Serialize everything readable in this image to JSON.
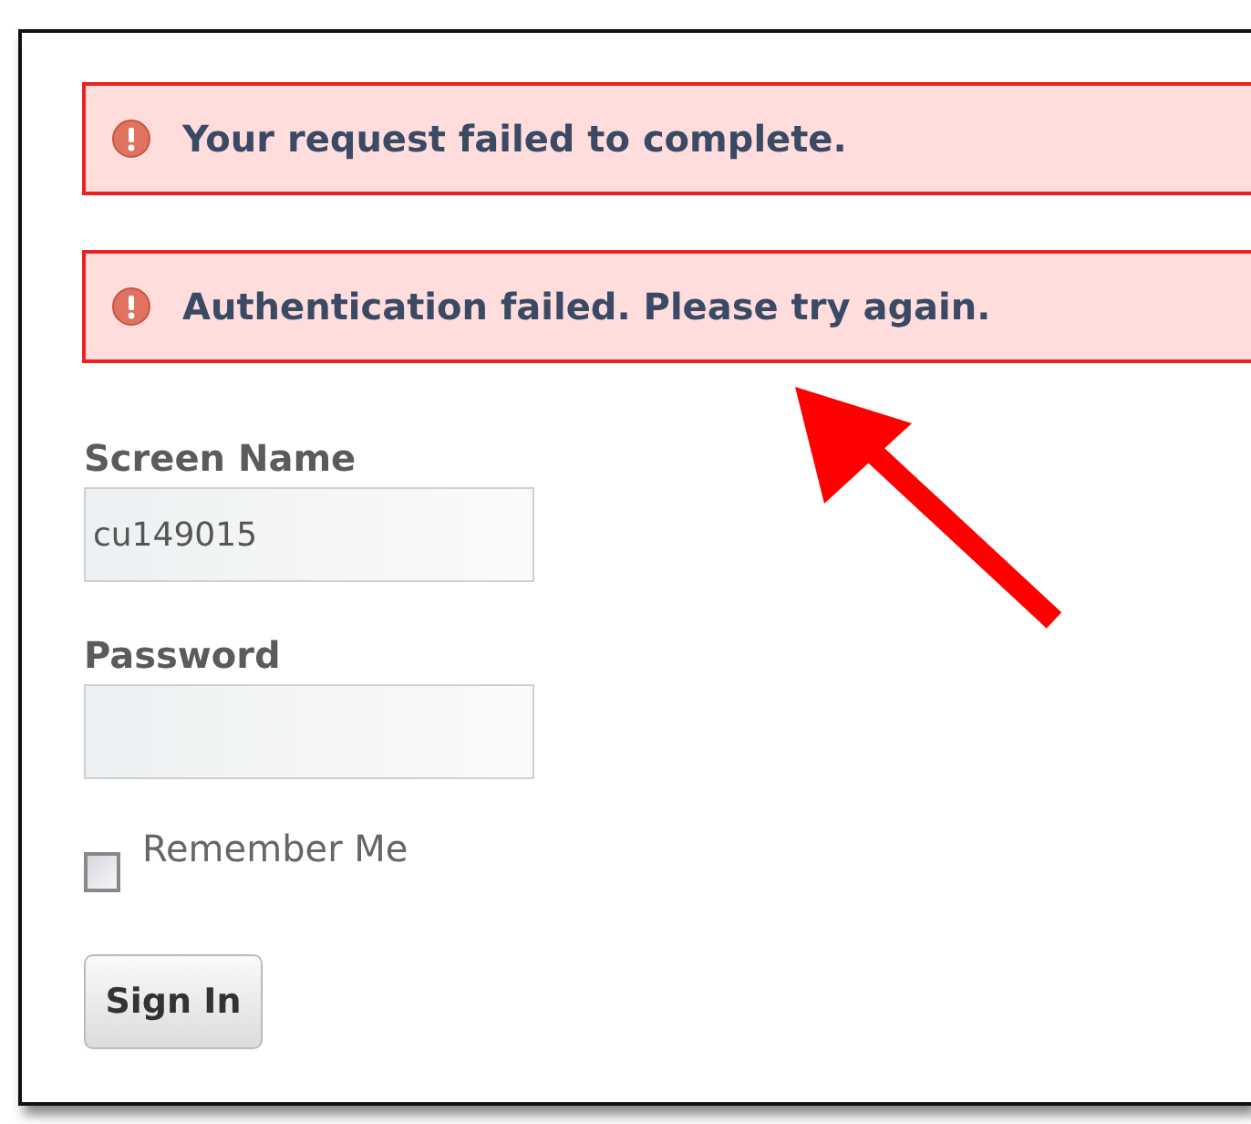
{
  "errors": [
    {
      "text": "Your request failed to complete."
    },
    {
      "text": "Authentication failed. Please try again."
    }
  ],
  "fields": [
    {
      "label": "Screen Name",
      "value": "cu149015"
    },
    {
      "label": "Password"
    }
  ],
  "remember_me": {
    "label": "Remember Me",
    "checked": false
  },
  "button": {
    "label": "Sign In"
  }
}
